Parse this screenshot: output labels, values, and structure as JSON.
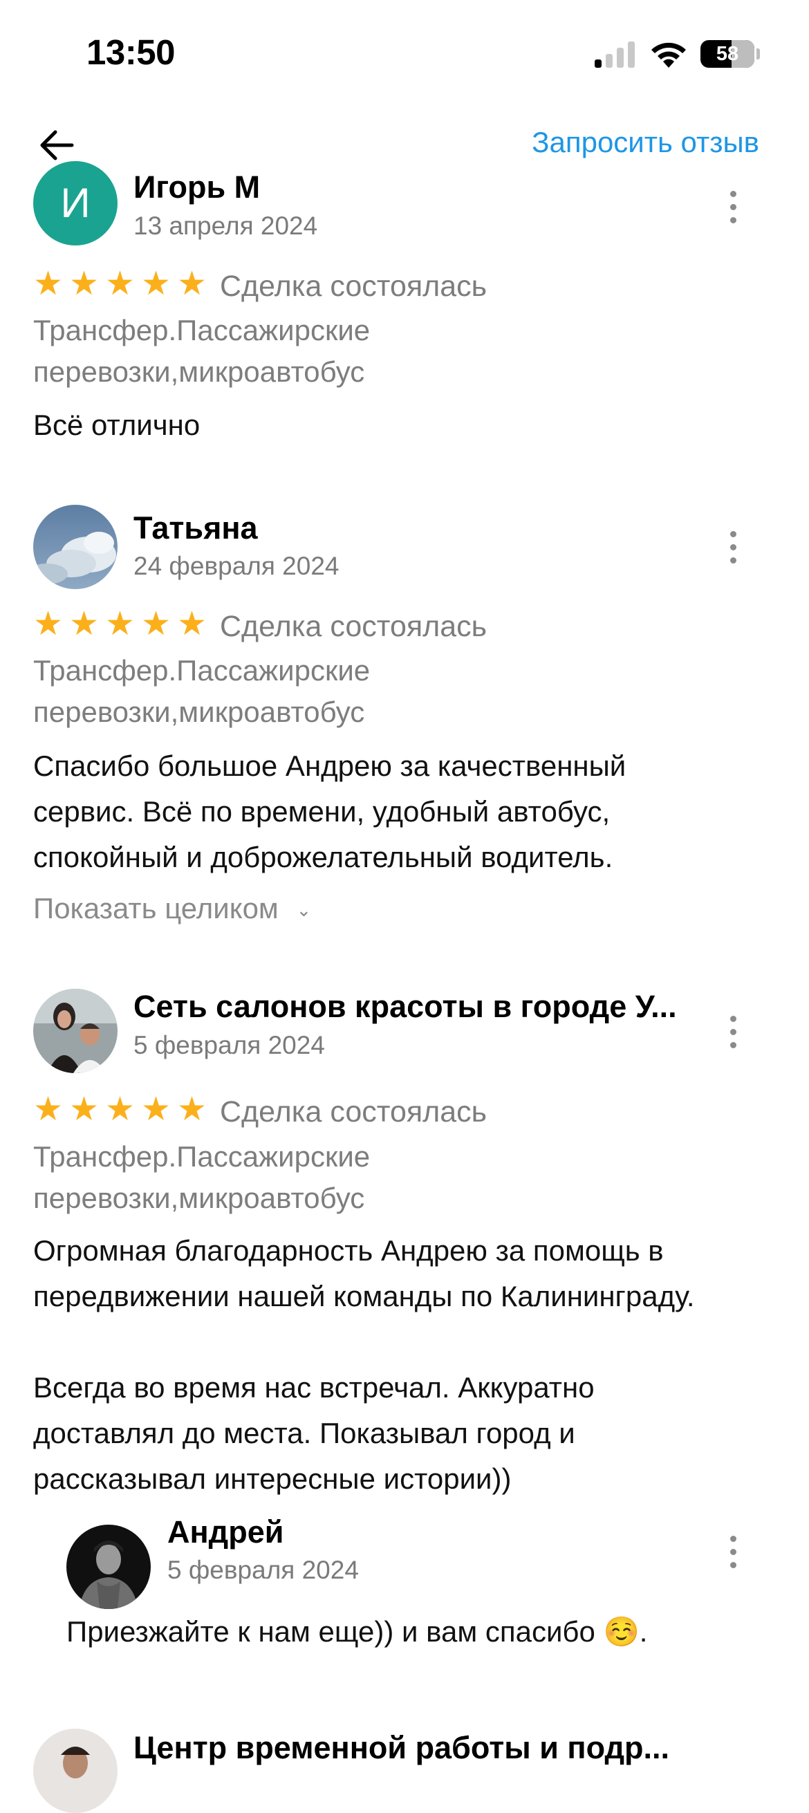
{
  "status_bar": {
    "time": "13:50",
    "battery": "58",
    "battery_fraction": 0.58
  },
  "header": {
    "request_review_label": "Запросить отзыв",
    "back_icon": "arrow-left-icon"
  },
  "reviews": [
    {
      "author": "Игорь М",
      "avatar_letter": "И",
      "date": "13 апреля 2024",
      "rating": 5,
      "deal_status": "Сделка состоялась",
      "category_line1": "Трансфер.Пассажирские",
      "category_line2": "перевозки,микроавтобус",
      "text": "Всё отлично"
    },
    {
      "author": "Татьяна",
      "avatar_icon": "clouds-photo-avatar",
      "date": "24 февраля 2024",
      "rating": 5,
      "deal_status": "Сделка состоялась",
      "category_line1": "Трансфер.Пассажирские",
      "category_line2": "перевозки,микроавтобус",
      "text": "Спасибо большое Андрею за качественный\nсервис. Всё по времени,  удобный автобус,\nспокойный и доброжелательный водитель.",
      "show_more": "Показать целиком"
    },
    {
      "author": "Сеть салонов красоты в городе У...",
      "avatar_icon": "salon-photo-avatar",
      "date": "5 февраля 2024",
      "rating": 5,
      "deal_status": "Сделка состоялась",
      "category_line1": "Трансфер.Пассажирские",
      "category_line2": "перевозки,микроавтобус",
      "text": "Огромная благодарность Андрею за помощь в\nпередвижении нашей команды  по Калининграду.\n\nВсегда во время нас встречал. Аккуратно\nдоставлял до места.  Показывал город и\nрассказывал интересные истории))",
      "reply": {
        "author": "Андрей",
        "date": "5 февраля 2024",
        "text": "Приезжайте к нам еще)) и вам спасибо ☺️."
      }
    },
    {
      "author": "Центр временной работы и подр...",
      "avatar_icon": "person-photo-avatar"
    }
  ]
}
